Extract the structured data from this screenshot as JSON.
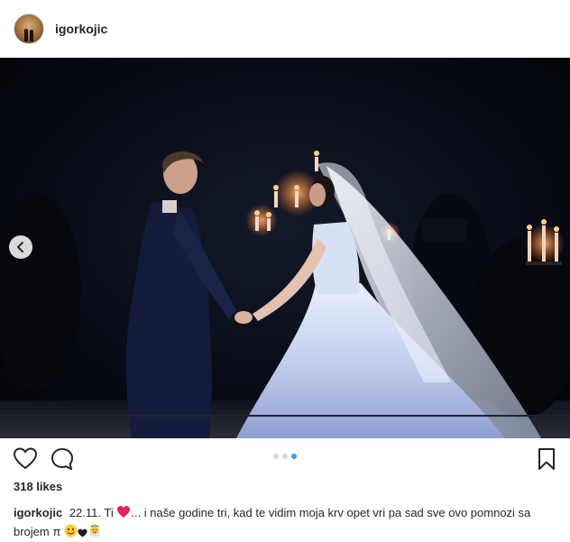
{
  "post": {
    "username": "igorkojic",
    "likes_text": "318 likes",
    "caption": {
      "username": "igorkojic",
      "part1": "22.11. Ti",
      "part2": "... i naše godine tri, kad te vidim moja krv opet vri pa sad sve ovo pomnozi sa brojem π"
    },
    "carousel": {
      "count": 3,
      "active_index": 3
    },
    "icons": {
      "avatar": "profile-avatar",
      "prev": "chevron-left-icon",
      "like": "heart-outline-icon",
      "comment": "comment-bubble-icon",
      "save": "bookmark-icon",
      "caption_emojis": [
        "red-heart-emoji",
        "smiling-face-emoji",
        "black-heart-emoji",
        "bride-emoji"
      ]
    },
    "colors": {
      "accent": "#3897f0",
      "text": "#262626",
      "heart_emoji": "#e0245e"
    }
  }
}
